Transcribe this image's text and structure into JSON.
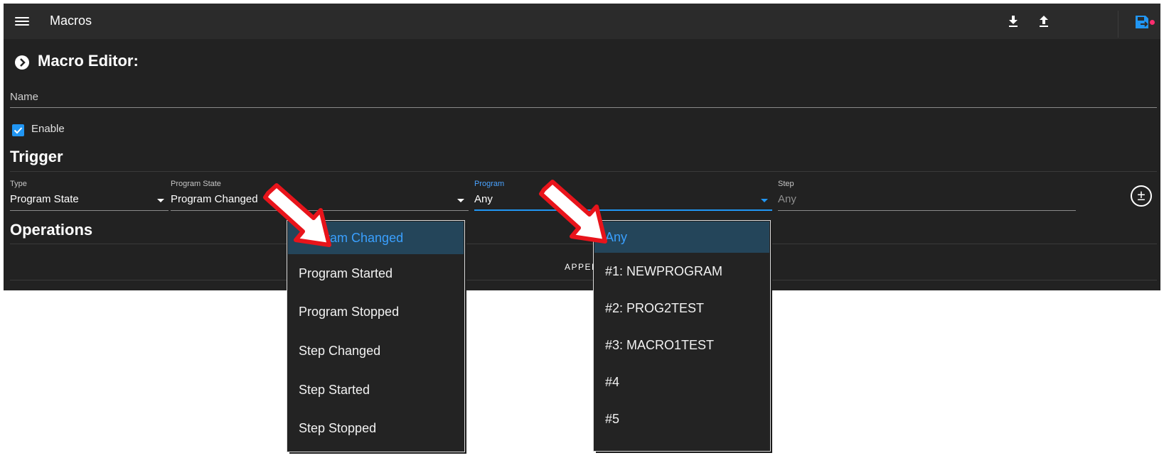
{
  "topbar": {
    "title": "Macros",
    "icons": [
      "menu-icon",
      "download-icon",
      "upload-icon",
      "save-icon"
    ],
    "accent": "#2196f3",
    "notification_color": "#ff2d6f"
  },
  "editor": {
    "title": "Macro Editor:",
    "name_label": "Name",
    "enable_label": "Enable",
    "enable_checked": true
  },
  "trigger": {
    "title": "Trigger",
    "fields": [
      {
        "label": "Type",
        "value": "Program State"
      },
      {
        "label": "Program State",
        "value": "Program Changed"
      },
      {
        "label": "Program",
        "value": "Any"
      },
      {
        "label": "Step",
        "value": "Any"
      }
    ],
    "add_remove_label": "±"
  },
  "operations": {
    "title": "Operations",
    "append_label": "APPEND"
  },
  "program_state_menu": {
    "items": [
      "Program Changed",
      "Program Started",
      "Program Stopped",
      "Step Changed",
      "Step Started",
      "Step Stopped"
    ],
    "selected_index": 0
  },
  "program_menu": {
    "items": [
      "Any",
      "#1: NEWPROGRAM",
      "#2: PROG2TEST",
      "#3: MACRO1TEST",
      "#4",
      "#5"
    ],
    "selected_index": 0
  },
  "annotation": {
    "arrow_color": "#e8141b",
    "arrow_fill": "#ffffff"
  }
}
